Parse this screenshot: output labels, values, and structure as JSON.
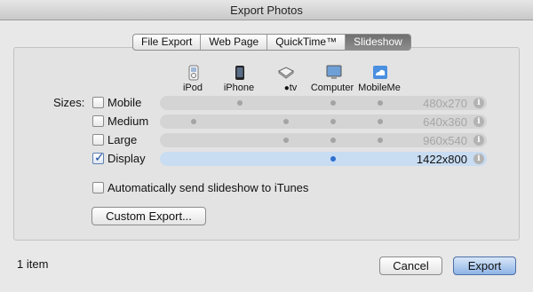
{
  "window": {
    "title": "Export Photos"
  },
  "tabs": [
    {
      "label": "File Export",
      "active": false
    },
    {
      "label": "Web Page",
      "active": false
    },
    {
      "label": "QuickTime™",
      "active": false
    },
    {
      "label": "Slideshow",
      "active": true
    }
  ],
  "devices": [
    {
      "label": "iPod",
      "icon": "ipod-icon"
    },
    {
      "label": "iPhone",
      "icon": "iphone-icon"
    },
    {
      "label": "tv",
      "icon": "apple-tv-icon",
      "prefix_icon": "apple-logo-icon"
    },
    {
      "label": "Computer",
      "icon": "computer-icon"
    },
    {
      "label": "MobileMe",
      "icon": "mobileme-icon"
    }
  ],
  "sizes_label": "Sizes:",
  "sizes": [
    {
      "label": "Mobile",
      "checked": false,
      "resolution": "480x270",
      "compat": [
        false,
        true,
        false,
        true,
        true
      ]
    },
    {
      "label": "Medium",
      "checked": false,
      "resolution": "640x360",
      "compat": [
        true,
        false,
        true,
        true,
        true
      ]
    },
    {
      "label": "Large",
      "checked": false,
      "resolution": "960x540",
      "compat": [
        false,
        false,
        true,
        true,
        true
      ]
    },
    {
      "label": "Display",
      "checked": true,
      "resolution": "1422x800",
      "compat": [
        false,
        false,
        false,
        true,
        false
      ]
    }
  ],
  "auto_send": {
    "label": "Automatically send slideshow to iTunes",
    "checked": false
  },
  "custom_export_label": "Custom Export...",
  "status": "1 item",
  "cancel_label": "Cancel",
  "export_label": "Export",
  "colors": {
    "selected_row": "#c8dcf2",
    "dot": "#a4a4a4",
    "dot_selected": "#2f6fd0",
    "default_button": "#8fb4e6"
  }
}
